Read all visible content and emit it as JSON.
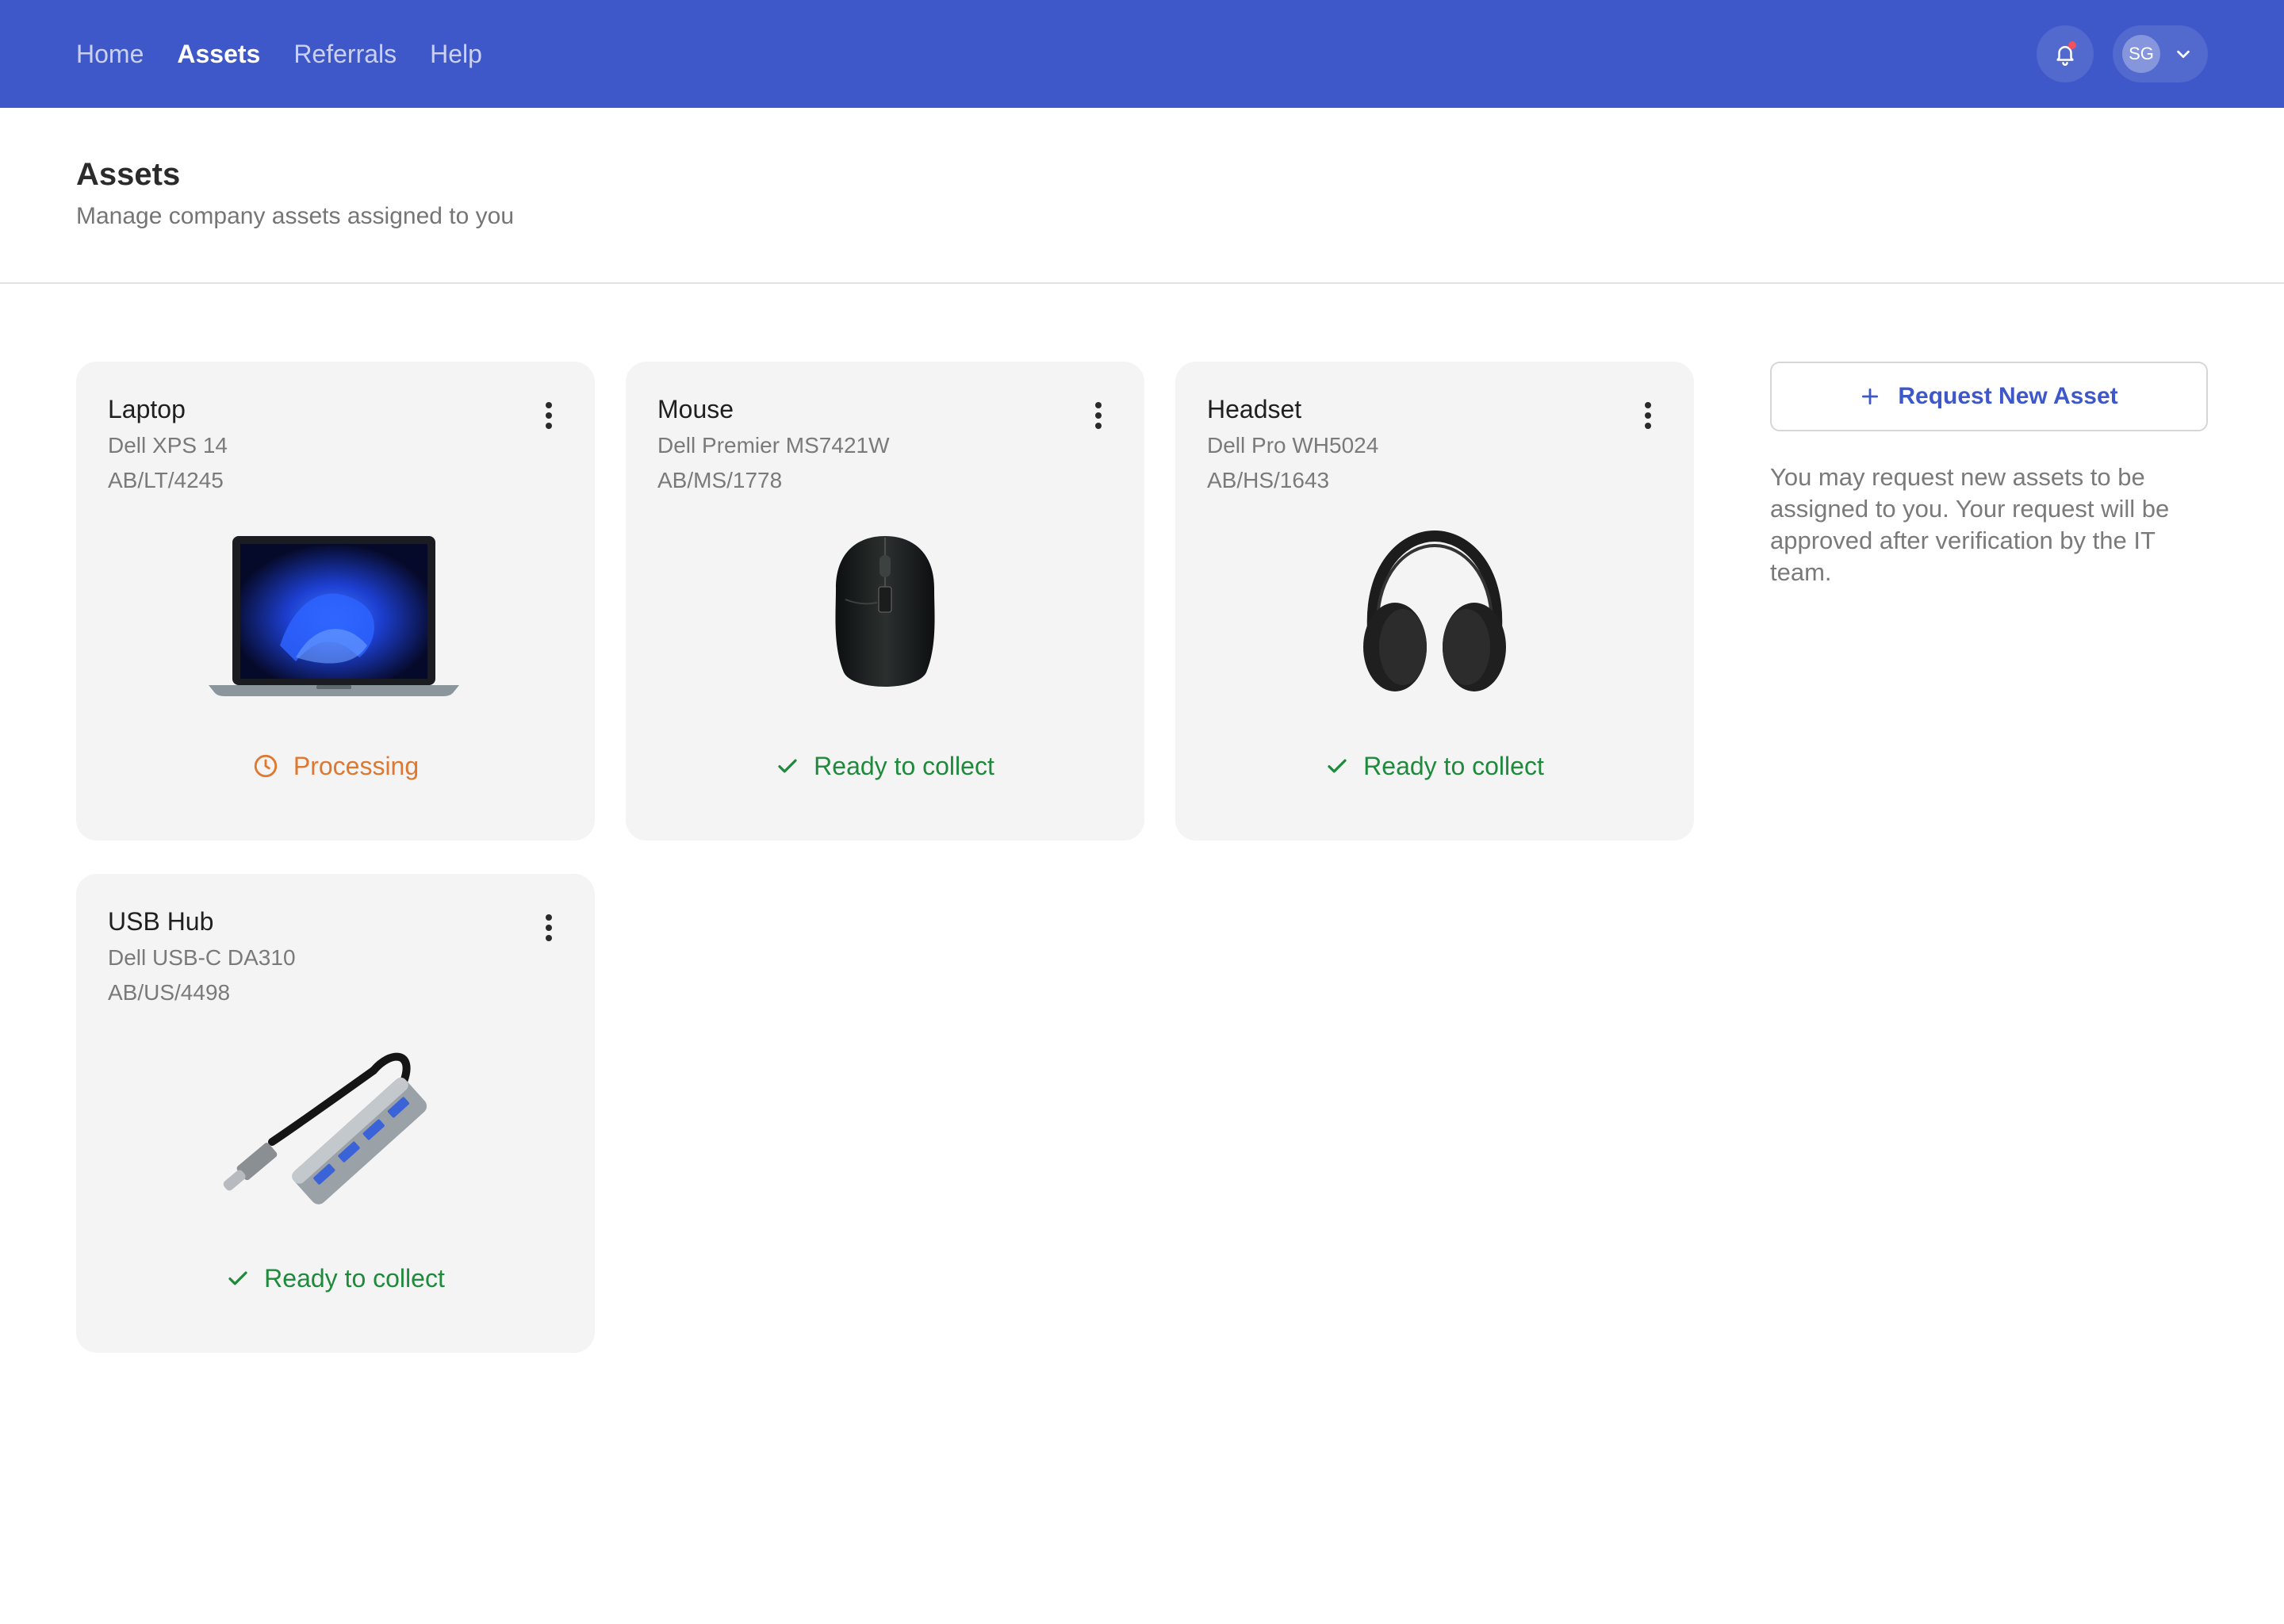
{
  "nav": {
    "items": [
      {
        "label": "Home"
      },
      {
        "label": "Assets"
      },
      {
        "label": "Referrals"
      },
      {
        "label": "Help"
      }
    ],
    "active": "Assets",
    "user_initials": "SG",
    "icons": [
      "bell-icon",
      "chevron-down-icon"
    ]
  },
  "page": {
    "title": "Assets",
    "subtitle": "Manage company assets assigned to you"
  },
  "assets": [
    {
      "name": "Laptop",
      "model": "Dell XPS 14",
      "tag": "AB/LT/4245",
      "status": "Processing",
      "status_kind": "processing"
    },
    {
      "name": "Mouse",
      "model": "Dell Premier MS7421W",
      "tag": "AB/MS/1778",
      "status": "Ready to collect",
      "status_kind": "ready"
    },
    {
      "name": "Headset",
      "model": "Dell Pro WH5024",
      "tag": "AB/HS/1643",
      "status": "Ready to collect",
      "status_kind": "ready"
    },
    {
      "name": "USB Hub",
      "model": "Dell USB-C DA310",
      "tag": "AB/US/4498",
      "status": "Ready to collect",
      "status_kind": "ready"
    }
  ],
  "request": {
    "button_label": "Request New Asset",
    "note": "You may request new assets to be assigned to you. Your request will be approved after verification by the IT team."
  },
  "colors": {
    "topbar": "#3f58c9",
    "processing": "#e0772f",
    "ready": "#1f8a3c",
    "accent": "#3f58c9"
  }
}
